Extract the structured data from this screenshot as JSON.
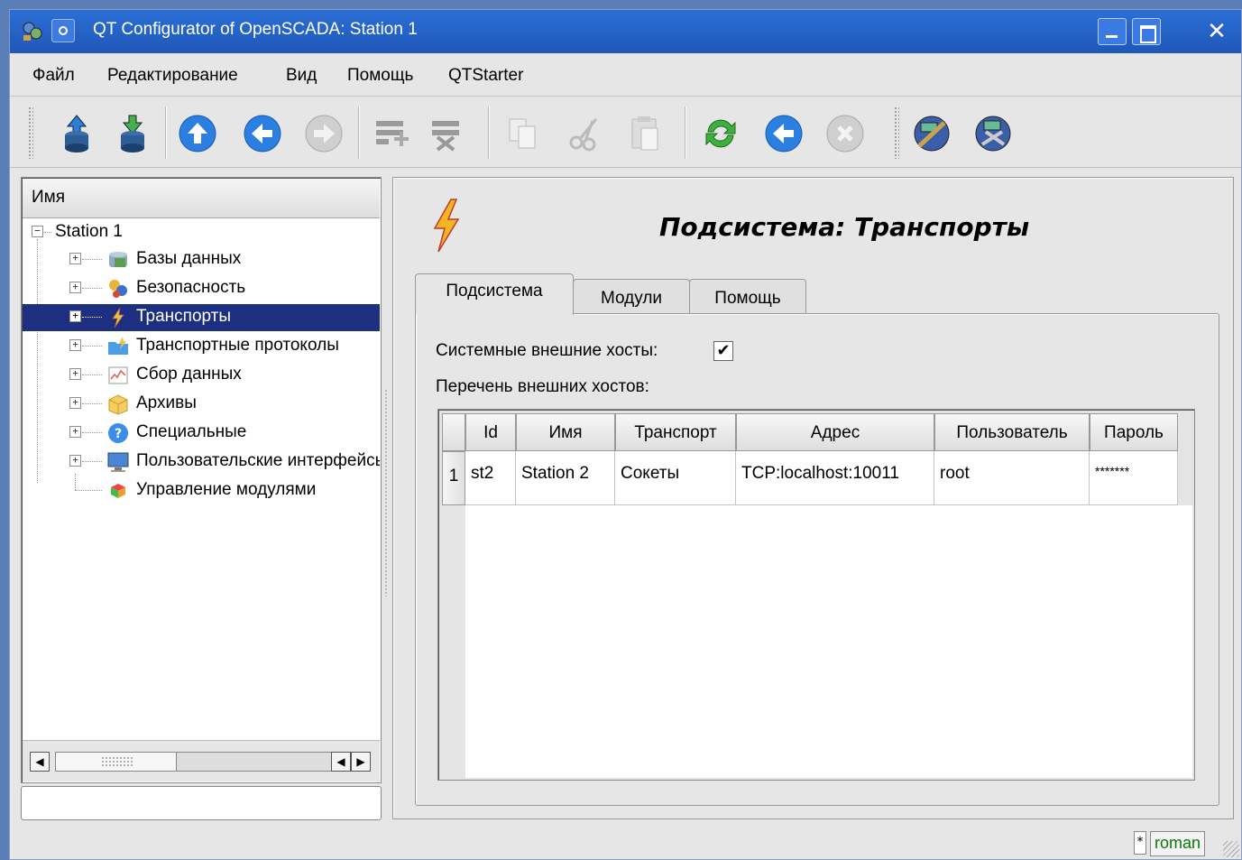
{
  "window": {
    "title": "QT Configurator of OpenSCADA: Station 1"
  },
  "menu": [
    {
      "label": "Файл"
    },
    {
      "label": "Редактирование"
    },
    {
      "label": "Вид"
    },
    {
      "label": "Помощь"
    },
    {
      "label": "QTStarter"
    }
  ],
  "toolbar": {
    "icons": [
      "db-load-icon",
      "db-save-icon",
      "up-icon",
      "back-icon",
      "forward-icon",
      "item-add-icon",
      "item-delete-icon",
      "copy-icon",
      "cut-icon",
      "paste-icon",
      "refresh-icon",
      "start-icon",
      "stop-icon",
      "configurator-icon",
      "configurator-alt-icon"
    ]
  },
  "tree": {
    "header": "Имя",
    "root": "Station 1",
    "items": [
      {
        "label": "Базы данных",
        "icon": "database-icon"
      },
      {
        "label": "Безопасность",
        "icon": "security-icon"
      },
      {
        "label": "Транспорты",
        "icon": "lightning-icon",
        "selected": true
      },
      {
        "label": "Транспортные протоколы",
        "icon": "folder-protocols-icon"
      },
      {
        "label": "Сбор данных",
        "icon": "chart-icon"
      },
      {
        "label": "Архивы",
        "icon": "archive-box-icon"
      },
      {
        "label": "Специальные",
        "icon": "help-circle-icon"
      },
      {
        "label": "Пользовательские интерфейсы",
        "icon": "monitor-icon"
      },
      {
        "label": "Управление модулями",
        "icon": "modules-icon"
      }
    ]
  },
  "page": {
    "title": "Подсистема: Транспорты",
    "tabs": [
      {
        "label": "Подсистема",
        "active": true
      },
      {
        "label": "Модули"
      },
      {
        "label": "Помощь"
      }
    ],
    "sys_hosts_label": "Системные внешние хосты:",
    "sys_hosts_checked": true,
    "check_mark": "✔",
    "hosts_list_label": "Перечень внешних хостов:"
  },
  "table": {
    "columns": [
      "Id",
      "Имя",
      "Транспорт",
      "Адрес",
      "Пользователь",
      "Пароль"
    ],
    "rows": [
      {
        "num": "1",
        "cells": [
          "st2",
          "Station 2",
          "Сокеты",
          "TCP:localhost:10011",
          "root",
          "*******"
        ]
      }
    ]
  },
  "statusbar": {
    "modified": "*",
    "user": "roman"
  },
  "colors": {
    "titlebar": "#2b6fd6",
    "selection": "#1c2f80",
    "user": "#0a7a0a"
  }
}
